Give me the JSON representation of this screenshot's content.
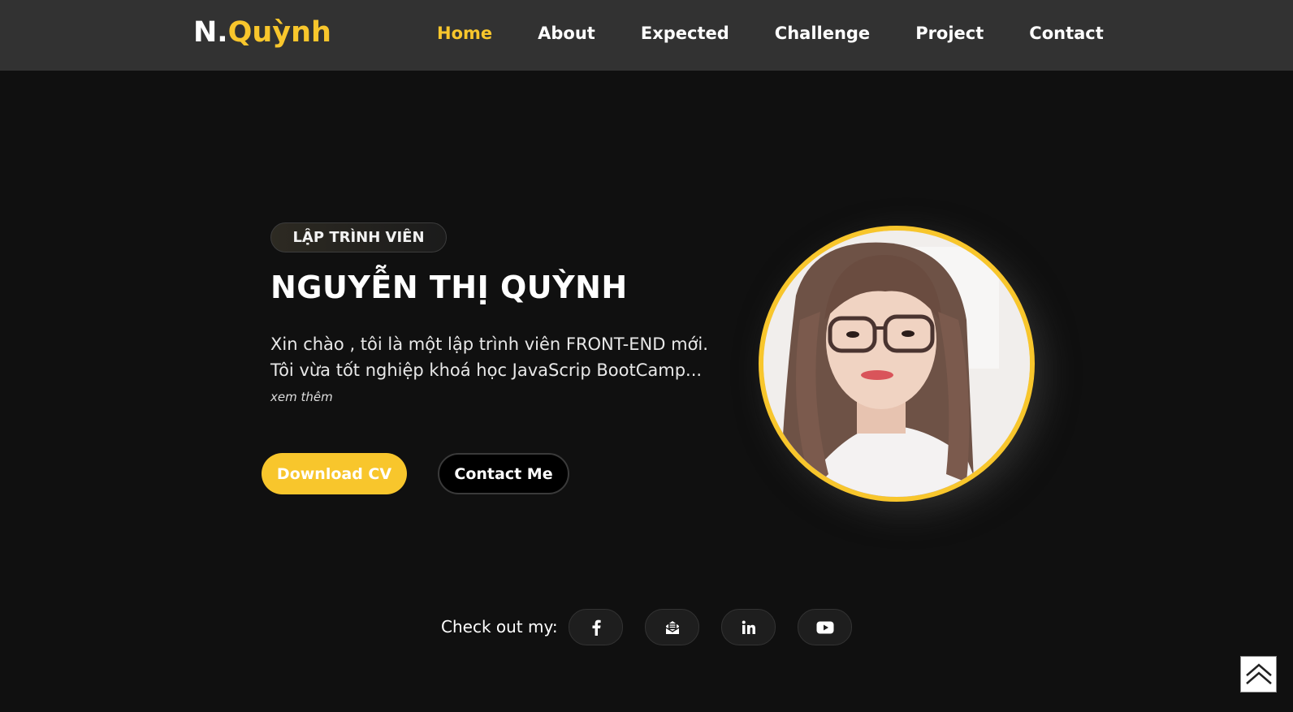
{
  "header": {
    "logo_prefix": "N.",
    "logo_name": "Quỳnh",
    "nav": [
      {
        "label": "Home",
        "active": true
      },
      {
        "label": "About",
        "active": false
      },
      {
        "label": "Expected",
        "active": false
      },
      {
        "label": "Challenge",
        "active": false
      },
      {
        "label": "Project",
        "active": false
      },
      {
        "label": "Contact",
        "active": false
      }
    ]
  },
  "hero": {
    "badge": "LẬP TRÌNH VIÊN",
    "name": "NGUYỄN THỊ QUỲNH",
    "intro": "Xin chào , tôi là một lập trình viên FRONT-END mới. Tôi vừa tốt nghiệp khoá học JavaScrip BootCamp...",
    "see_more": "xem thêm",
    "download_cv": "Download CV",
    "contact_me": "Contact Me",
    "avatar_icon": "profile-photo"
  },
  "socials": {
    "label": "Check out my:",
    "items": [
      {
        "icon": "facebook-icon"
      },
      {
        "icon": "mail-icon"
      },
      {
        "icon": "linkedin-icon"
      },
      {
        "icon": "youtube-icon"
      }
    ]
  },
  "back_to_top_icon": "double-chevron-up-icon",
  "colors": {
    "accent": "#f8c62c",
    "background": "#101010",
    "header": "#323232"
  }
}
